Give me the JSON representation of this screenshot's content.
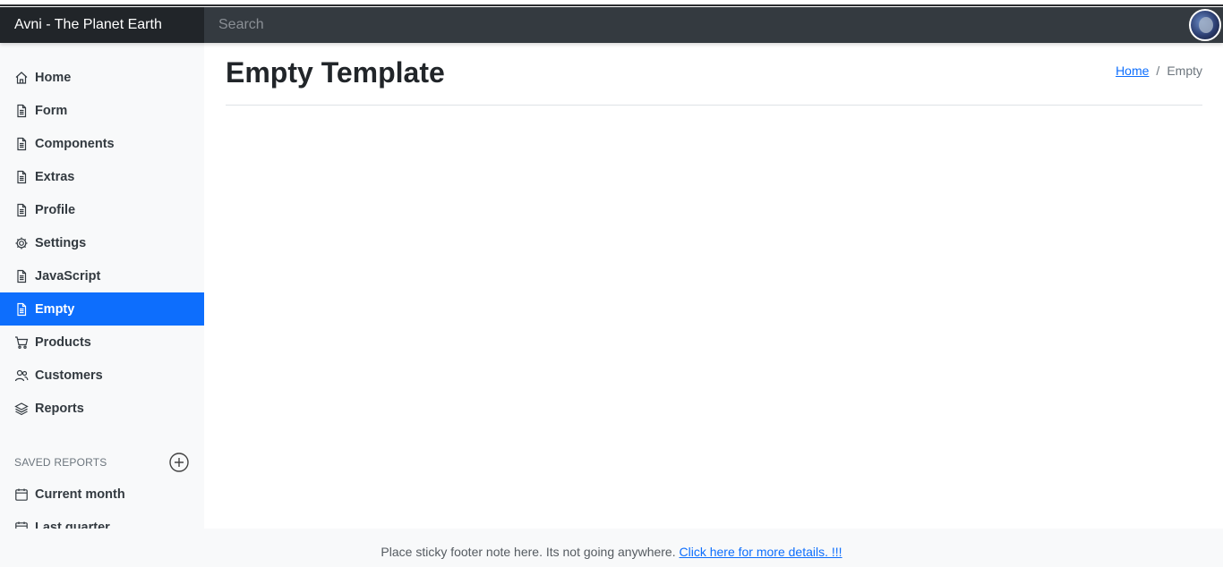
{
  "app": {
    "brand": "Avni - The Planet Earth"
  },
  "search": {
    "placeholder": "Search"
  },
  "sidebar": {
    "items": [
      {
        "label": "Home",
        "icon": "home-icon"
      },
      {
        "label": "Form",
        "icon": "file-icon"
      },
      {
        "label": "Components",
        "icon": "file-icon"
      },
      {
        "label": "Extras",
        "icon": "file-icon"
      },
      {
        "label": "Profile",
        "icon": "file-icon"
      },
      {
        "label": "Settings",
        "icon": "gear-icon"
      },
      {
        "label": "JavaScript",
        "icon": "file-icon"
      },
      {
        "label": "Empty",
        "icon": "file-icon",
        "active": true
      },
      {
        "label": "Products",
        "icon": "cart-icon"
      },
      {
        "label": "Customers",
        "icon": "users-icon"
      },
      {
        "label": "Reports",
        "icon": "layers-icon"
      }
    ],
    "saved_reports": {
      "heading": "SAVED REPORTS",
      "items": [
        {
          "label": "Current month",
          "icon": "calendar-icon"
        },
        {
          "label": "Last quarter",
          "icon": "calendar-icon"
        }
      ]
    }
  },
  "main": {
    "title": "Empty Template",
    "breadcrumb": {
      "home": "Home",
      "separator": "/",
      "current": "Empty"
    }
  },
  "footer": {
    "text": "Place sticky footer note here. Its not going anywhere. ",
    "link": "Click here for more details. !!!"
  },
  "colors": {
    "accent": "#0d6efd",
    "navbar": "#343a40",
    "brand_bg": "#212529",
    "sidebar_bg": "#f8f9fa"
  }
}
